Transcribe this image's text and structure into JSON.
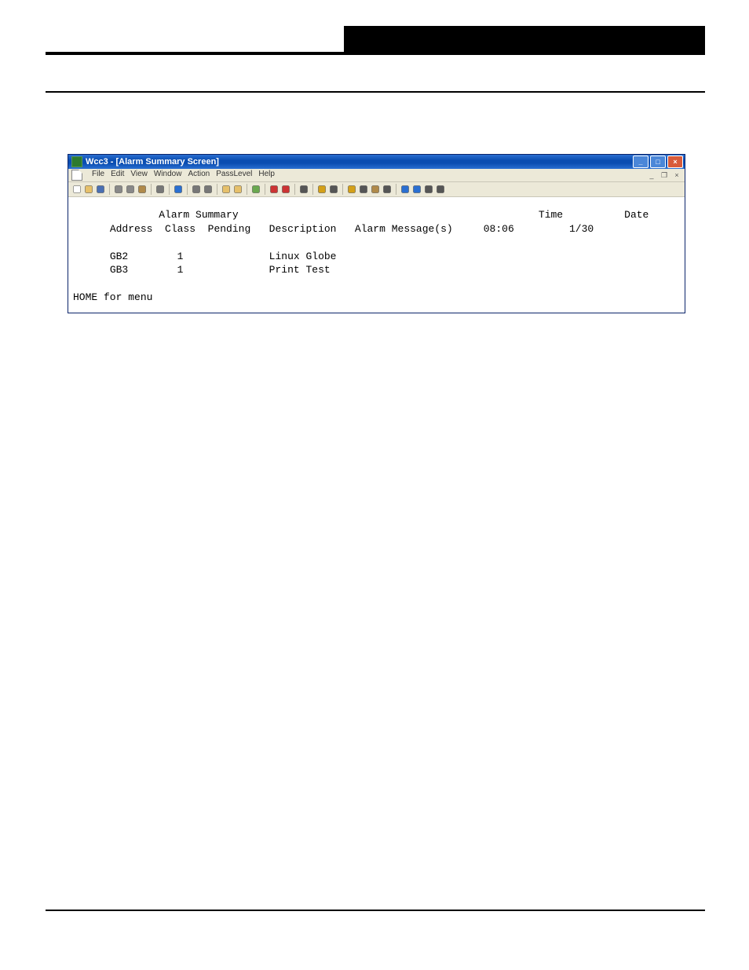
{
  "window": {
    "title": "Wcc3 - [Alarm Summary Screen]",
    "menubar": {
      "items": [
        "File",
        "Edit",
        "View",
        "Window",
        "Action",
        "PassLevel",
        "Help"
      ]
    },
    "toolbar_icons": [
      "new-icon",
      "open-icon",
      "save-icon",
      "sep",
      "cut-icon",
      "copy-icon",
      "paste-icon",
      "sep",
      "print-icon",
      "sep",
      "help-icon",
      "sep",
      "print-preview-a-icon",
      "print-preview-b-icon",
      "sep",
      "folder-a-icon",
      "folder-b-icon",
      "sep",
      "bookmark-icon",
      "sep",
      "bell-a-icon",
      "bell-b-icon",
      "sep",
      "filter-icon",
      "sep",
      "star-icon",
      "wand-icon",
      "sep",
      "badge-star-icon",
      "link-icon",
      "lock-icon",
      "window-icon",
      "sep",
      "tool-a-icon",
      "tool-b-icon",
      "tool-c-icon",
      "tool-d-icon"
    ],
    "win_controls": {
      "minimize": "_",
      "maximize": "□",
      "close": "×"
    },
    "mdi_controls": {
      "minimize": "_",
      "restore": "❐",
      "close": "×"
    }
  },
  "content": {
    "header_center": "Alarm Summary",
    "time_label": "Time",
    "time_value": "08:06",
    "date_label": "Date",
    "date_value": "1/30",
    "columns": {
      "address": "Address",
      "class": "Class",
      "pending": "Pending",
      "description": "Description",
      "alarm_messages": "Alarm Message(s)"
    },
    "rows": [
      {
        "address": "GB2",
        "class": "1",
        "pending": "",
        "description": "Linux Globe",
        "messages": ""
      },
      {
        "address": "GB3",
        "class": "1",
        "pending": "",
        "description": "Print Test",
        "messages": ""
      }
    ],
    "footer": "HOME for menu"
  }
}
